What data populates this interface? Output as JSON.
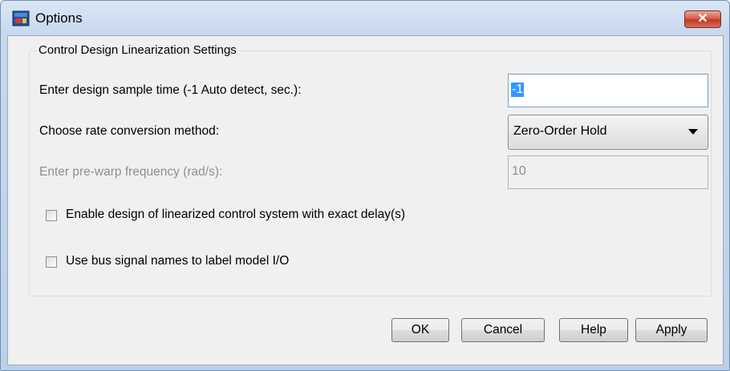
{
  "window": {
    "title": "Options",
    "close_label": "✕"
  },
  "group": {
    "title": "Control Design Linearization Settings"
  },
  "sample_time": {
    "label": "Enter design sample time (-1 Auto detect, sec.):",
    "value": "-1"
  },
  "rate_conversion": {
    "label": "Choose rate conversion method:",
    "selected": "Zero-Order Hold"
  },
  "prewarp": {
    "label": "Enter pre-warp frequency (rad/s):",
    "value": "10",
    "enabled": false
  },
  "checkboxes": [
    {
      "label": "Enable design of linearized control system with exact delay(s)",
      "checked": false
    },
    {
      "label": "Use bus signal names to label model I/O",
      "checked": false
    }
  ],
  "buttons": {
    "ok": "OK",
    "cancel": "Cancel",
    "help": "Help",
    "apply": "Apply"
  },
  "colors": {
    "selection": "#3399ff",
    "close_button": "#c23a22",
    "disabled_text": "#8f8f8f"
  }
}
